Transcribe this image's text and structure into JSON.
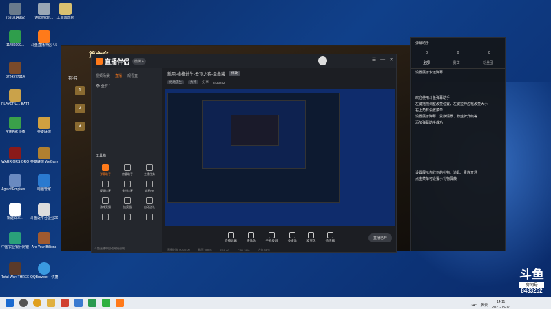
{
  "desktop": {
    "icons": [
      {
        "label": "7691814962",
        "color": "#6a7b8c"
      },
      {
        "label": "webwxget...",
        "color": "#9aa7b5"
      },
      {
        "label": "工业国国片",
        "color": "#d8c070"
      },
      {
        "label": "11486009...",
        "color": "#2f9e4c"
      },
      {
        "label": "斗鱼直播伴侣 4.5",
        "color": "#ff7a1a"
      },
      {
        "label": "3724977814",
        "color": "#7a4a2a"
      },
      {
        "label": "PLAYERU... BATTLEGR...",
        "color": "#caa24a"
      },
      {
        "label": "全民K歌直播",
        "color": "#3aa04a"
      },
      {
        "label": "英雄联盟",
        "color": "#d0a040"
      },
      {
        "label": "WARRIORS OROCHI 4...",
        "color": "#8a1a1a"
      },
      {
        "label": "英雄联盟 WeGame版",
        "color": "#b08030"
      },
      {
        "label": "Age of Empires ...",
        "color": "#6a8ac0"
      },
      {
        "label": "电脑管家",
        "color": "#2a7ad0"
      },
      {
        "label": "新建文本...",
        "color": "#ffffff"
      },
      {
        "label": "斗鱼近平台企业2021年...",
        "color": "#dddddd"
      },
      {
        "label": "中国农业银行网银助手",
        "color": "#2aa07a"
      },
      {
        "label": "Are Your Billions",
        "color": "#a05a30"
      },
      {
        "label": "Total War: THREE KI...",
        "color": "#5a3a2a"
      },
      {
        "label": "QQBrowser - 快捷方式",
        "color": "#3a9ae0"
      }
    ]
  },
  "game_window": {
    "title": "第六名",
    "rank_header": "排名",
    "ranks": [
      "1",
      "2",
      "3"
    ]
  },
  "app": {
    "name": "直播伴侣",
    "version": "微笑 ▸",
    "left_tabs": [
      "视频场景",
      "直播",
      "观看直"
    ],
    "active_tab_index": 1,
    "scene_label": "全屏 1",
    "tools_title": "工具箱",
    "tools": [
      "弹幕助手",
      "房管助手",
      "主播任务",
      "视频连麦",
      "多人连麦",
      "连麦PK",
      "游戏竞猜",
      "抽奖器",
      "自动送礼",
      "",
      "",
      ""
    ],
    "left_footer": "斗鱼直播中自动开始录制",
    "room_title": "新用-格格并生-云顶之弈-单鼻装",
    "room_badge": "修改",
    "info_chips": [
      "绝地求生",
      "大神",
      "分享"
    ],
    "room_id": "8433252",
    "bottom_buttons": [
      "直播屏幕",
      "摄像头",
      "手机投屏",
      "多媒体",
      "麦克风",
      "扬声器"
    ],
    "start_button": "直播已开",
    "status_items": [
      "直播时长 00:00:00",
      "码率 0kbps",
      "FPS 60",
      "CPU 28%",
      "内存 48%"
    ]
  },
  "helper": {
    "title": "弹幕助手",
    "stats": [
      "0",
      "0",
      "0"
    ],
    "tabs": [
      "全部",
      "贵宾",
      "粉丝团"
    ],
    "active_tab_index": 0,
    "intro": "设置展示永远弹幕",
    "message1": "欢迎使用斗鱼弹幕助手\n左键拖拽调整改变位置，左键拉伸边框改变大小\n右上角有设置菜单\n设置展示弹幕、贵族情景、粉丝牌升级等\n添加弹幕助手成功",
    "message2": "设置展示你收到的礼物、道具、贵族开通\n点击菜单可设置小礼物屏蔽"
  },
  "watermark": {
    "logo": "斗鱼",
    "sub": "房间号",
    "room_id": "8433252"
  },
  "taskbar": {
    "weather": "34°C 多云",
    "time": "14:11",
    "date": "2021-08-07"
  }
}
